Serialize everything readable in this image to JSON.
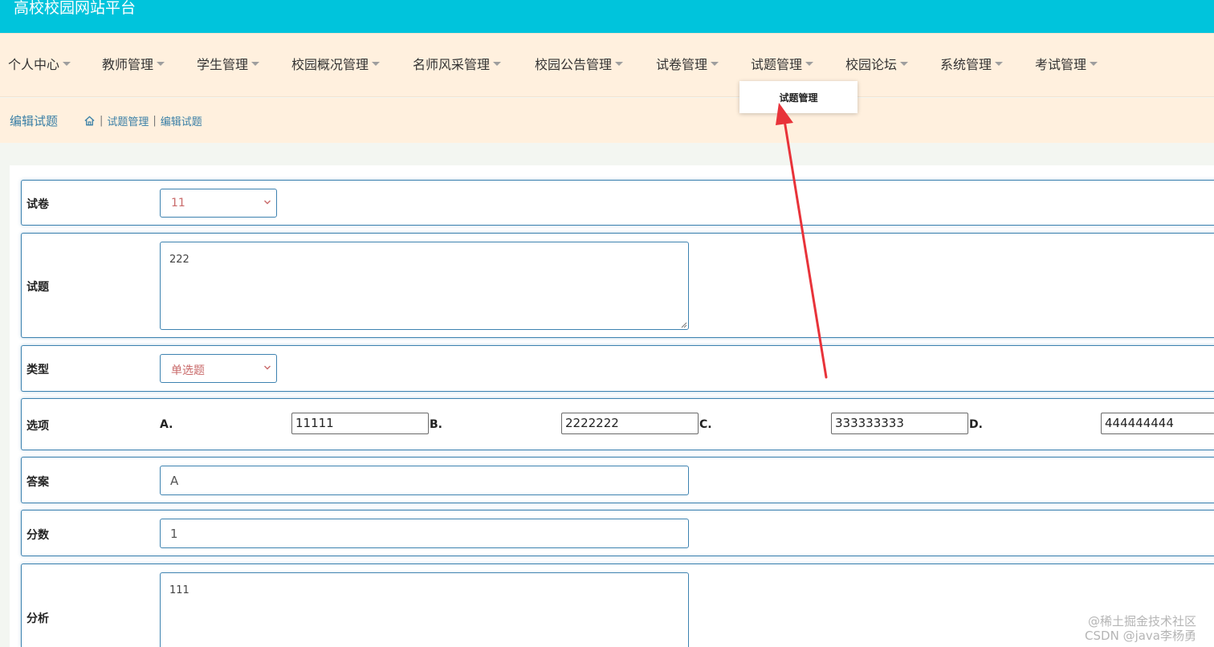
{
  "site": {
    "title": "高校校园网站平台"
  },
  "nav": {
    "items": [
      {
        "label": "个人中心"
      },
      {
        "label": "教师管理"
      },
      {
        "label": "学生管理"
      },
      {
        "label": "校园概况管理"
      },
      {
        "label": "名师风采管理"
      },
      {
        "label": "校园公告管理"
      },
      {
        "label": "试卷管理"
      },
      {
        "label": "试题管理"
      },
      {
        "label": "校园论坛"
      },
      {
        "label": "系统管理"
      },
      {
        "label": "考试管理"
      }
    ],
    "dropdown": {
      "item": "试题管理"
    }
  },
  "breadcrumb": {
    "page_title": "编辑试题",
    "path": [
      "试题管理",
      "编辑试题"
    ]
  },
  "form": {
    "paper": {
      "label": "试卷",
      "value": "11"
    },
    "question": {
      "label": "试题",
      "value": "222"
    },
    "type": {
      "label": "类型",
      "value": "单选题"
    },
    "options": {
      "label": "选项",
      "items": [
        {
          "letter": "A.",
          "value": "11111"
        },
        {
          "letter": "B.",
          "value": "2222222"
        },
        {
          "letter": "C.",
          "value": "333333333"
        },
        {
          "letter": "D.",
          "value": "444444444"
        }
      ]
    },
    "answer": {
      "label": "答案",
      "value": "A"
    },
    "score": {
      "label": "分数",
      "value": "1"
    },
    "analysis": {
      "label": "分析",
      "value": "111"
    }
  },
  "watermark": {
    "line1": "@稀土掘金技术社区",
    "line2": "CSDN @java李杨勇"
  },
  "colors": {
    "topbar": "#00c4dc",
    "navbar": "#fff0de",
    "border": "#3d82b0",
    "accent_text": "#3a7fa6",
    "select_text": "#c96a6a",
    "arrow": "#e8333a"
  }
}
